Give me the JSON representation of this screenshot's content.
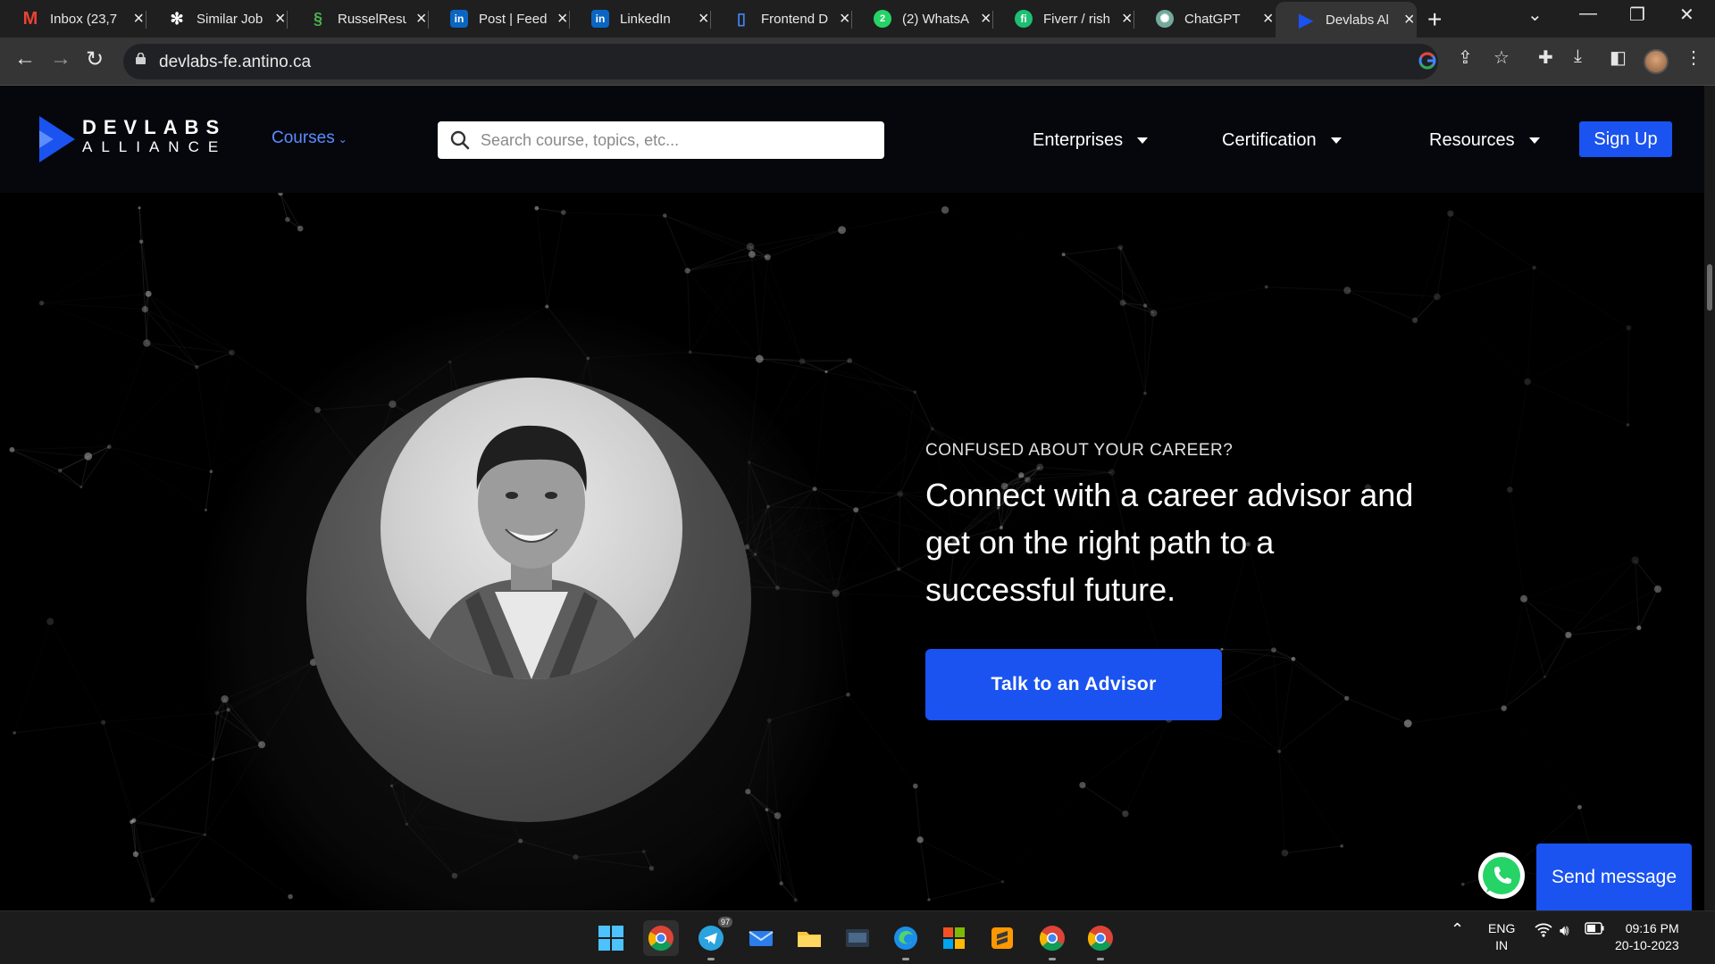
{
  "browser": {
    "tabs": [
      {
        "title": "Inbox (23,7",
        "icon": "gmail-icon",
        "color": "#ea4335"
      },
      {
        "title": "Similar Job",
        "icon": "openai-icon",
        "color": "#ffffff"
      },
      {
        "title": "RusselResu",
        "icon": "resume-icon",
        "color": "#4caf50"
      },
      {
        "title": "Post | Feed",
        "icon": "linkedin-icon",
        "color": "#0a66c2"
      },
      {
        "title": "LinkedIn",
        "icon": "linkedin-icon",
        "color": "#0a66c2"
      },
      {
        "title": "Frontend D",
        "icon": "bookmark-icon",
        "color": "#4285f4"
      },
      {
        "title": "(2) WhatsA",
        "icon": "whatsapp-icon",
        "color": "#25d366"
      },
      {
        "title": "Fiverr / rish",
        "icon": "fiverr-icon",
        "color": "#1dbf73"
      },
      {
        "title": "ChatGPT",
        "icon": "chatgpt-icon",
        "color": "#74aa9c"
      },
      {
        "title": "Devlabs Al",
        "icon": "devlabs-icon",
        "color": "#1a53f0",
        "active": true
      }
    ],
    "url": "devlabs-fe.antino.ca"
  },
  "site": {
    "logo_line1": "DEVLABS",
    "logo_line2": "ALLIANCE",
    "courses_label": "Courses",
    "search_placeholder": "Search course, topics, etc...",
    "nav": {
      "enterprises": "Enterprises",
      "certification": "Certification",
      "resources": "Resources"
    },
    "signup_label": "Sign Up"
  },
  "hero": {
    "eyebrow": "CONFUSED ABOUT YOUR CAREER?",
    "headline": "Connect with a career advisor and get on the right path to a successful future.",
    "cta_label": "Talk to an Advisor"
  },
  "chat": {
    "send_label": "Send message"
  },
  "taskbar": {
    "telegram_badge": "97",
    "lang_line1": "ENG",
    "lang_line2": "IN",
    "time": "09:16 PM",
    "date": "20-10-2023"
  },
  "colors": {
    "accent": "#1a53f0",
    "courses_link": "#5b8dff"
  }
}
